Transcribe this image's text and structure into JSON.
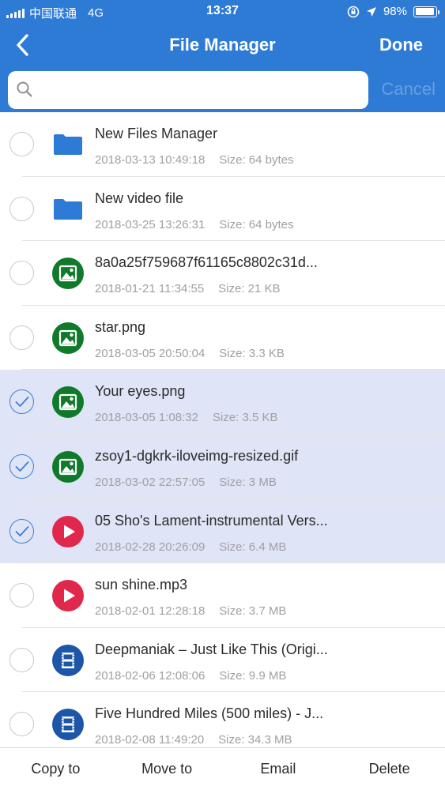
{
  "status_bar": {
    "carrier": "中国联通",
    "network": "4G",
    "time": "13:37",
    "battery": "98%",
    "battery_level": 0.98
  },
  "navbar": {
    "title": "File Manager",
    "done_label": "Done",
    "back_icon": "chevron-left-icon"
  },
  "search": {
    "placeholder": "",
    "value": "",
    "cancel_label": "Cancel"
  },
  "colors": {
    "header": "#2e7bd6",
    "selected_row": "#dfe4f6",
    "folder": "#2e7bd6",
    "image": "#0f7a2a",
    "audio": "#e0284d",
    "video": "#1d55a8"
  },
  "files": [
    {
      "name": "New Files Manager",
      "date": "2018-03-13 10:49:18",
      "size": "Size: 64 bytes",
      "type": "folder",
      "selected": false
    },
    {
      "name": "New video file",
      "date": "2018-03-25 13:26:31",
      "size": "Size: 64 bytes",
      "type": "folder",
      "selected": false
    },
    {
      "name": "8a0a25f759687f61165c8802c31d...",
      "date": "2018-01-21 11:34:55",
      "size": "Size: 21 KB",
      "type": "image",
      "selected": false
    },
    {
      "name": "star.png",
      "date": "2018-03-05 20:50:04",
      "size": "Size: 3.3 KB",
      "type": "image",
      "selected": false
    },
    {
      "name": "Your eyes.png",
      "date": "2018-03-05 1:08:32",
      "size": "Size: 3.5 KB",
      "type": "image",
      "selected": true
    },
    {
      "name": "zsoy1-dgkrk-iloveimg-resized.gif",
      "date": "2018-03-02 22:57:05",
      "size": "Size: 3 MB",
      "type": "image",
      "selected": true
    },
    {
      "name": "05 Sho's Lament-instrumental Vers...",
      "date": "2018-02-28 20:26:09",
      "size": "Size: 6.4 MB",
      "type": "audio",
      "selected": true
    },
    {
      "name": "sun shine.mp3",
      "date": "2018-02-01 12:28:18",
      "size": "Size: 3.7 MB",
      "type": "audio",
      "selected": false
    },
    {
      "name": "Deepmaniak – Just Like This (Origi...",
      "date": "2018-02-06 12:08:06",
      "size": "Size: 9.9 MB",
      "type": "video",
      "selected": false
    },
    {
      "name": "Five Hundred Miles (500 miles) - J...",
      "date": "2018-02-08 11:49:20",
      "size": "Size: 34.3 MB",
      "type": "video",
      "selected": false
    }
  ],
  "toolbar": {
    "copy_label": "Copy to",
    "move_label": "Move to",
    "email_label": "Email",
    "delete_label": "Delete"
  }
}
